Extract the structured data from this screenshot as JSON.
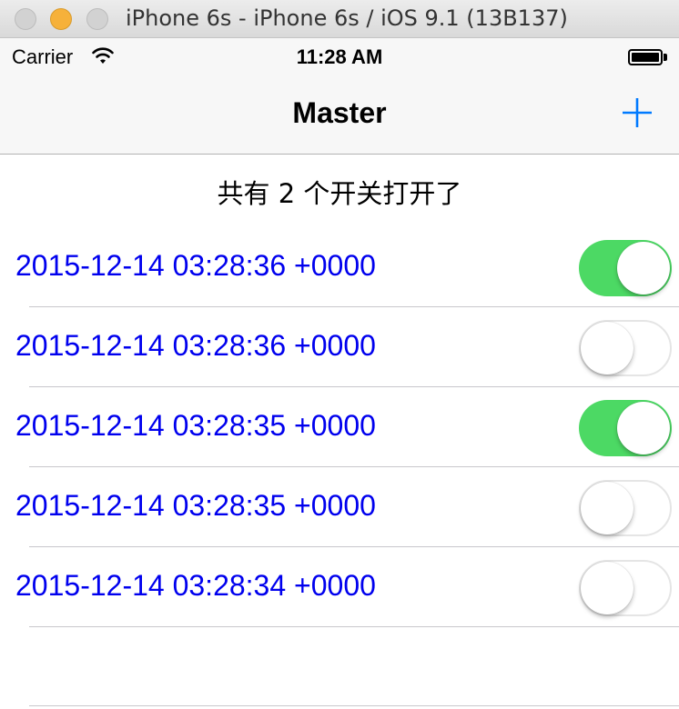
{
  "window": {
    "title": "iPhone 6s - iPhone 6s / iOS 9.1 (13B137)"
  },
  "status_bar": {
    "carrier": "Carrier",
    "time": "11:28 AM",
    "battery_level": 1.0
  },
  "nav_bar": {
    "title": "Master",
    "add_icon": "plus-icon"
  },
  "table": {
    "header": "共有 2 个开关打开了",
    "rows": [
      {
        "label": "2015-12-14 03:28:36 +0000",
        "switch_on": true
      },
      {
        "label": "2015-12-14 03:28:36 +0000",
        "switch_on": false
      },
      {
        "label": "2015-12-14 03:28:35 +0000",
        "switch_on": true
      },
      {
        "label": "2015-12-14 03:28:35 +0000",
        "switch_on": false
      },
      {
        "label": "2015-12-14 03:28:34 +0000",
        "switch_on": false
      }
    ]
  },
  "colors": {
    "accent": "#007aff",
    "switch_on": "#4cd964",
    "row_text": "#0000ee"
  }
}
